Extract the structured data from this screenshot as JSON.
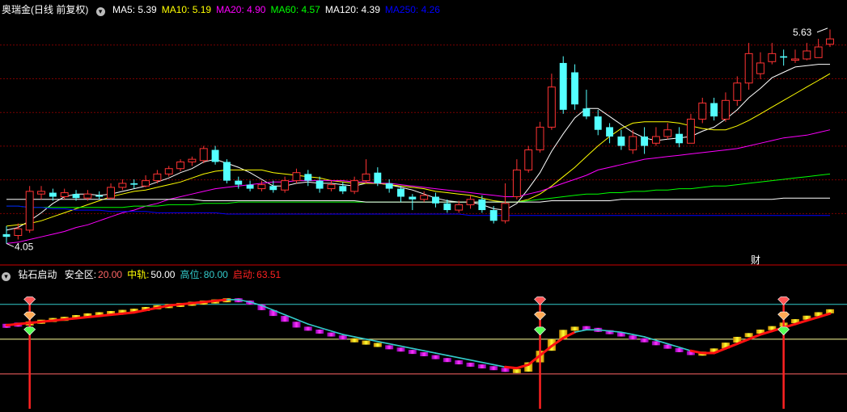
{
  "header_top": {
    "title": "奥瑞金(日线 前复权)",
    "items": [
      {
        "label": "MA5: 5.39",
        "color": "#ffffff"
      },
      {
        "label": "MA10: 5.19",
        "color": "#ffff00"
      },
      {
        "label": "MA20: 4.90",
        "color": "#ff00ff"
      },
      {
        "label": "MA60: 4.57",
        "color": "#00ff00"
      },
      {
        "label": "MA120: 4.39",
        "color": "#ffffff"
      },
      {
        "label": "MA250: 4.26",
        "color": "#0000ff"
      }
    ]
  },
  "header_bottom": {
    "title": "钻石启动",
    "items": [
      {
        "label": "安全区:",
        "value": "20.00",
        "label_color": "#ffffff",
        "value_color": "#ff6666"
      },
      {
        "label": "中轨:",
        "value": "50.00",
        "label_color": "#ffff00",
        "value_color": "#ffffff"
      },
      {
        "label": "高位:",
        "value": "80.00",
        "label_color": "#33cccc",
        "value_color": "#33cccc"
      },
      {
        "label": "启动:",
        "value": "63.51",
        "label_color": "#ff2222",
        "value_color": "#ff2222"
      }
    ]
  },
  "annotations": {
    "high_label": "5.63",
    "low_label": "4.05",
    "fin_mark": "财"
  },
  "colors": {
    "up": "#ff3333",
    "down": "#54ffff",
    "grid": "#7a0000",
    "divider": "#cc0000"
  },
  "chart_data": [
    {
      "type": "candlestick",
      "ylim": [
        3.95,
        5.75
      ],
      "candles": [
        [
          4.12,
          4.1,
          4.18,
          4.05
        ],
        [
          4.11,
          4.16,
          4.2,
          4.08
        ],
        [
          4.15,
          4.44,
          4.48,
          4.13
        ],
        [
          4.42,
          4.44,
          4.48,
          4.38
        ],
        [
          4.43,
          4.4,
          4.46,
          4.37
        ],
        [
          4.4,
          4.43,
          4.46,
          4.38
        ],
        [
          4.42,
          4.39,
          4.45,
          4.37
        ],
        [
          4.39,
          4.42,
          4.45,
          4.37
        ],
        [
          4.41,
          4.4,
          4.44,
          4.38
        ],
        [
          4.39,
          4.47,
          4.5,
          4.38
        ],
        [
          4.47,
          4.5,
          4.53,
          4.45
        ],
        [
          4.5,
          4.49,
          4.53,
          4.46
        ],
        [
          4.48,
          4.52,
          4.56,
          4.47
        ],
        [
          4.52,
          4.57,
          4.6,
          4.5
        ],
        [
          4.57,
          4.61,
          4.63,
          4.55
        ],
        [
          4.61,
          4.66,
          4.68,
          4.59
        ],
        [
          4.66,
          4.68,
          4.7,
          4.63
        ],
        [
          4.67,
          4.76,
          4.78,
          4.65
        ],
        [
          4.75,
          4.66,
          4.78,
          4.64
        ],
        [
          4.66,
          4.52,
          4.68,
          4.5
        ],
        [
          4.52,
          4.49,
          4.55,
          4.46
        ],
        [
          4.49,
          4.46,
          4.52,
          4.44
        ],
        [
          4.46,
          4.49,
          4.52,
          4.44
        ],
        [
          4.48,
          4.45,
          4.52,
          4.43
        ],
        [
          4.45,
          4.52,
          4.55,
          4.43
        ],
        [
          4.52,
          4.58,
          4.61,
          4.5
        ],
        [
          4.57,
          4.52,
          4.6,
          4.48
        ],
        [
          4.52,
          4.46,
          4.55,
          4.43
        ],
        [
          4.46,
          4.49,
          4.52,
          4.44
        ],
        [
          4.48,
          4.44,
          4.51,
          4.42
        ],
        [
          4.44,
          4.52,
          4.55,
          4.42
        ],
        [
          4.52,
          4.57,
          4.68,
          4.5
        ],
        [
          4.58,
          4.5,
          4.62,
          4.48
        ],
        [
          4.5,
          4.46,
          4.53,
          4.43
        ],
        [
          4.46,
          4.4,
          4.48,
          4.36
        ],
        [
          4.4,
          4.38,
          4.42,
          4.3
        ],
        [
          4.38,
          4.41,
          4.44,
          4.36
        ],
        [
          4.4,
          4.35,
          4.43,
          4.32
        ],
        [
          4.35,
          4.3,
          4.38,
          4.28
        ],
        [
          4.3,
          4.34,
          4.37,
          4.28
        ],
        [
          4.34,
          4.38,
          4.41,
          4.31
        ],
        [
          4.38,
          4.3,
          4.41,
          4.28
        ],
        [
          4.3,
          4.22,
          4.33,
          4.2
        ],
        [
          4.22,
          4.35,
          4.5,
          4.2
        ],
        [
          4.4,
          4.6,
          4.68,
          4.38
        ],
        [
          4.6,
          4.75,
          4.78,
          4.58
        ],
        [
          4.75,
          4.92,
          4.96,
          4.73
        ],
        [
          4.92,
          5.22,
          5.32,
          4.9
        ],
        [
          5.4,
          5.05,
          5.45,
          5.02
        ],
        [
          5.33,
          5.09,
          5.39,
          5.05
        ],
        [
          5.06,
          5.0,
          5.2,
          4.98
        ],
        [
          5.0,
          4.9,
          5.05,
          4.86
        ],
        [
          4.92,
          4.85,
          4.95,
          4.8
        ],
        [
          4.85,
          4.78,
          4.9,
          4.75
        ],
        [
          4.75,
          4.85,
          4.9,
          4.72
        ],
        [
          4.85,
          4.78,
          4.92,
          4.72
        ],
        [
          4.8,
          4.85,
          4.92,
          4.78
        ],
        [
          4.85,
          4.9,
          4.95,
          4.83
        ],
        [
          4.87,
          4.8,
          4.92,
          4.77
        ],
        [
          4.8,
          4.98,
          5.02,
          4.8
        ],
        [
          4.98,
          5.1,
          5.14,
          4.95
        ],
        [
          5.1,
          5.0,
          5.14,
          4.97
        ],
        [
          4.98,
          5.12,
          5.18,
          4.96
        ],
        [
          5.12,
          5.25,
          5.3,
          5.08
        ],
        [
          5.25,
          5.47,
          5.55,
          5.2
        ],
        [
          5.32,
          5.4,
          5.48,
          5.28
        ],
        [
          5.41,
          5.47,
          5.55,
          5.39
        ],
        [
          5.45,
          5.44,
          5.5,
          5.38
        ],
        [
          5.42,
          5.43,
          5.5,
          5.4
        ],
        [
          5.43,
          5.49,
          5.55,
          5.42
        ],
        [
          5.44,
          5.52,
          5.58,
          5.44
        ],
        [
          5.54,
          5.58,
          5.65,
          5.52
        ]
      ],
      "ma": [
        {
          "name": "MA5",
          "color": "#ffffff",
          "values": [
            4.15,
            4.17,
            4.22,
            4.28,
            4.35,
            4.4,
            4.42,
            4.42,
            4.41,
            4.42,
            4.44,
            4.46,
            4.48,
            4.51,
            4.54,
            4.58,
            4.61,
            4.66,
            4.68,
            4.65,
            4.62,
            4.58,
            4.53,
            4.48,
            4.48,
            4.5,
            4.51,
            4.5,
            4.5,
            4.49,
            4.48,
            4.5,
            4.5,
            4.49,
            4.47,
            4.45,
            4.42,
            4.39,
            4.37,
            4.36,
            4.36,
            4.34,
            4.31,
            4.3,
            4.35,
            4.46,
            4.58,
            4.74,
            4.87,
            4.99,
            5.06,
            5.06,
            5.0,
            4.94,
            4.88,
            4.84,
            4.82,
            4.83,
            4.84,
            4.85,
            4.89,
            4.92,
            4.98,
            5.05,
            5.14,
            5.21,
            5.29,
            5.33,
            5.37,
            5.38,
            5.39,
            5.39
          ]
        },
        {
          "name": "MA10",
          "color": "#ffff00",
          "values": [
            4.18,
            4.19,
            4.2,
            4.22,
            4.25,
            4.28,
            4.31,
            4.34,
            4.37,
            4.4,
            4.42,
            4.44,
            4.45,
            4.47,
            4.49,
            4.51,
            4.54,
            4.57,
            4.59,
            4.6,
            4.6,
            4.6,
            4.6,
            4.58,
            4.57,
            4.56,
            4.55,
            4.54,
            4.52,
            4.51,
            4.5,
            4.5,
            4.5,
            4.49,
            4.48,
            4.47,
            4.46,
            4.44,
            4.43,
            4.42,
            4.41,
            4.39,
            4.37,
            4.36,
            4.36,
            4.38,
            4.42,
            4.48,
            4.55,
            4.62,
            4.7,
            4.78,
            4.85,
            4.91,
            4.95,
            4.96,
            4.96,
            4.96,
            4.95,
            4.93,
            4.91,
            4.9,
            4.9,
            4.93,
            4.97,
            5.02,
            5.07,
            5.12,
            5.17,
            5.22,
            5.27,
            5.32
          ]
        },
        {
          "name": "MA20",
          "color": "#ff00ff",
          "values": [
            4.05,
            4.06,
            4.08,
            4.1,
            4.12,
            4.14,
            4.17,
            4.19,
            4.22,
            4.25,
            4.28,
            4.3,
            4.33,
            4.35,
            4.38,
            4.4,
            4.42,
            4.44,
            4.46,
            4.47,
            4.48,
            4.49,
            4.5,
            4.51,
            4.51,
            4.52,
            4.52,
            4.52,
            4.52,
            4.52,
            4.51,
            4.51,
            4.5,
            4.5,
            4.49,
            4.48,
            4.47,
            4.46,
            4.45,
            4.44,
            4.43,
            4.42,
            4.41,
            4.4,
            4.4,
            4.42,
            4.44,
            4.47,
            4.5,
            4.53,
            4.56,
            4.6,
            4.62,
            4.64,
            4.66,
            4.68,
            4.69,
            4.7,
            4.71,
            4.72,
            4.73,
            4.74,
            4.75,
            4.76,
            4.78,
            4.8,
            4.82,
            4.84,
            4.85,
            4.86,
            4.88,
            4.9
          ]
        },
        {
          "name": "MA60",
          "color": "#00ff00",
          "values": [
            4.33,
            4.33,
            4.32,
            4.32,
            4.32,
            4.32,
            4.32,
            4.32,
            4.32,
            4.32,
            4.32,
            4.33,
            4.33,
            4.33,
            4.34,
            4.34,
            4.34,
            4.35,
            4.35,
            4.35,
            4.36,
            4.36,
            4.36,
            4.36,
            4.36,
            4.36,
            4.36,
            4.36,
            4.36,
            4.36,
            4.36,
            4.36,
            4.36,
            4.36,
            4.36,
            4.36,
            4.36,
            4.36,
            4.36,
            4.36,
            4.36,
            4.36,
            4.36,
            4.36,
            4.36,
            4.37,
            4.38,
            4.39,
            4.4,
            4.41,
            4.42,
            4.42,
            4.43,
            4.43,
            4.44,
            4.44,
            4.45,
            4.45,
            4.46,
            4.46,
            4.47,
            4.48,
            4.48,
            4.49,
            4.5,
            4.51,
            4.52,
            4.53,
            4.54,
            4.55,
            4.56,
            4.57
          ]
        },
        {
          "name": "MA120",
          "color": "#ffffff",
          "values": [
            4.38,
            4.38,
            4.38,
            4.38,
            4.38,
            4.38,
            4.38,
            4.38,
            4.38,
            4.38,
            4.38,
            4.38,
            4.38,
            4.38,
            4.38,
            4.38,
            4.38,
            4.37,
            4.37,
            4.37,
            4.37,
            4.37,
            4.37,
            4.37,
            4.37,
            4.37,
            4.37,
            4.37,
            4.37,
            4.37,
            4.37,
            4.36,
            4.36,
            4.36,
            4.36,
            4.36,
            4.36,
            4.36,
            4.36,
            4.36,
            4.36,
            4.36,
            4.36,
            4.36,
            4.36,
            4.36,
            4.36,
            4.37,
            4.37,
            4.37,
            4.37,
            4.37,
            4.37,
            4.38,
            4.38,
            4.38,
            4.38,
            4.38,
            4.38,
            4.38,
            4.38,
            4.38,
            4.38,
            4.38,
            4.38,
            4.38,
            4.38,
            4.39,
            4.39,
            4.39,
            4.39,
            4.39
          ]
        },
        {
          "name": "MA250",
          "color": "#0000ff",
          "values": [
            4.33,
            4.33,
            4.32,
            4.32,
            4.31,
            4.31,
            4.3,
            4.3,
            4.3,
            4.29,
            4.29,
            4.29,
            4.29,
            4.28,
            4.28,
            4.28,
            4.28,
            4.28,
            4.28,
            4.27,
            4.27,
            4.27,
            4.27,
            4.27,
            4.27,
            4.27,
            4.27,
            4.27,
            4.27,
            4.27,
            4.27,
            4.27,
            4.27,
            4.27,
            4.27,
            4.27,
            4.27,
            4.27,
            4.27,
            4.27,
            4.26,
            4.26,
            4.26,
            4.26,
            4.26,
            4.26,
            4.26,
            4.26,
            4.26,
            4.26,
            4.26,
            4.26,
            4.26,
            4.26,
            4.26,
            4.26,
            4.26,
            4.26,
            4.26,
            4.26,
            4.26,
            4.26,
            4.26,
            4.26,
            4.26,
            4.26,
            4.26,
            4.26,
            4.26,
            4.26,
            4.26,
            4.26
          ]
        }
      ]
    },
    {
      "type": "indicator",
      "ylim": [
        -10,
        100
      ],
      "levels": [
        {
          "name": "安全区",
          "value": 20,
          "color": "#ff6666"
        },
        {
          "name": "中轨",
          "value": 50,
          "color": "#ffff99"
        },
        {
          "name": "高位",
          "value": 80,
          "color": "#33cccc"
        }
      ],
      "signals": [
        2,
        46,
        67
      ],
      "bars": [
        62,
        63,
        64,
        66,
        67,
        68,
        70,
        71,
        72,
        73,
        74,
        75,
        77,
        78,
        79,
        80,
        81,
        82,
        83,
        84,
        83,
        80,
        75,
        70,
        65,
        60,
        58,
        55,
        53,
        50,
        48,
        46,
        44,
        42,
        40,
        38,
        36,
        33,
        31,
        29,
        27,
        26,
        24,
        23,
        22,
        30,
        40,
        50,
        58,
        60,
        59,
        57,
        55,
        53,
        50,
        48,
        45,
        42,
        39,
        37,
        38,
        42,
        47,
        52,
        55,
        58,
        61,
        64,
        67,
        70,
        73,
        75
      ],
      "bars_up_flags": [
        0,
        0,
        1,
        1,
        1,
        1,
        1,
        1,
        1,
        1,
        1,
        1,
        1,
        1,
        1,
        1,
        1,
        1,
        1,
        1,
        0,
        0,
        0,
        0,
        0,
        0,
        0,
        0,
        0,
        0,
        1,
        1,
        1,
        0,
        0,
        0,
        0,
        0,
        0,
        0,
        0,
        0,
        0,
        0,
        1,
        1,
        1,
        1,
        1,
        1,
        0,
        0,
        0,
        0,
        0,
        0,
        0,
        0,
        0,
        0,
        1,
        1,
        1,
        1,
        1,
        1,
        1,
        1,
        1,
        1,
        1,
        1
      ],
      "slow_line": [
        62,
        63,
        64,
        65,
        66,
        67,
        68,
        69,
        70,
        71,
        72,
        73,
        75,
        77,
        79,
        80,
        81,
        82,
        83,
        84,
        84,
        82,
        79,
        75,
        71,
        67,
        63,
        60,
        57,
        54,
        52,
        50,
        48,
        46,
        44,
        42,
        40,
        38,
        36,
        34,
        32,
        30,
        28,
        26,
        25,
        28,
        36,
        44,
        51,
        56,
        58,
        58,
        57,
        56,
        54,
        52,
        49,
        46,
        43,
        40,
        38,
        38,
        42,
        46,
        50,
        54,
        57,
        60,
        63,
        66,
        69,
        72
      ],
      "slow_line_up": [
        1,
        1,
        1,
        1,
        1,
        1,
        1,
        1,
        1,
        1,
        1,
        1,
        1,
        1,
        1,
        1,
        1,
        1,
        1,
        1,
        0,
        0,
        0,
        0,
        0,
        0,
        0,
        0,
        0,
        0,
        0,
        0,
        0,
        0,
        0,
        0,
        0,
        0,
        0,
        0,
        0,
        0,
        0,
        0,
        1,
        1,
        1,
        1,
        1,
        1,
        0,
        0,
        0,
        0,
        0,
        0,
        0,
        0,
        0,
        0,
        1,
        1,
        1,
        1,
        1,
        1,
        1,
        1,
        1,
        1,
        1,
        1
      ]
    }
  ]
}
